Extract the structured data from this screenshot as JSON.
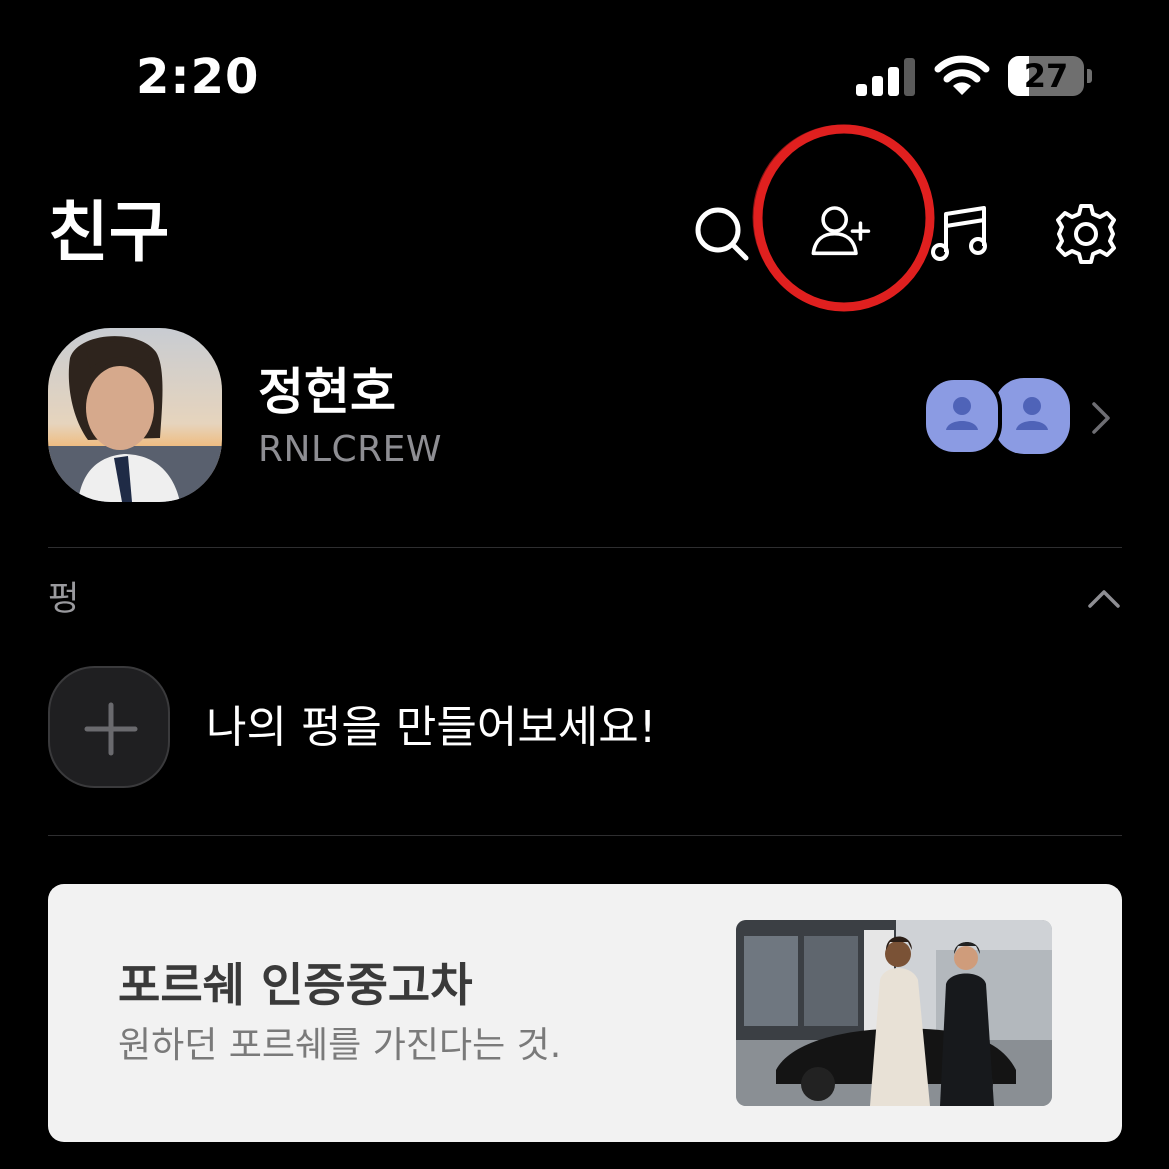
{
  "status_bar": {
    "time": "2:20",
    "battery_level": "27",
    "battery_fraction": 0.27,
    "signal_bars": 3
  },
  "header": {
    "title": "친구",
    "icons": [
      "search-icon",
      "add-friend-icon",
      "music-icon",
      "settings-icon"
    ]
  },
  "profile": {
    "name": "정현호",
    "status_message": "RNLCREW"
  },
  "pung": {
    "section_label": "펑",
    "create_prompt": "나의 펑을 만들어보세요!"
  },
  "ad": {
    "title": "포르쉐 인증중고차",
    "subtitle": "원하던 포르쉐를 가진다는 것."
  },
  "colors": {
    "background": "#000000",
    "annotation_red": "#e0201f",
    "multi_profile_purple": "#8b9be3",
    "ad_background": "#f2f2f2"
  }
}
